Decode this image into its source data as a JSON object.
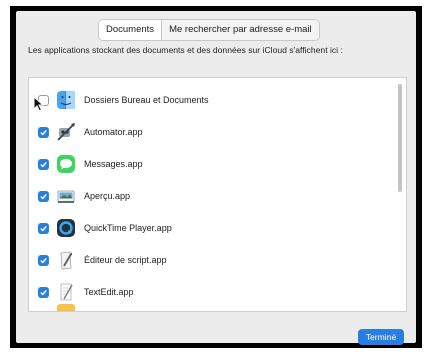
{
  "tabs": [
    {
      "label": "Documents",
      "selected": true
    },
    {
      "label": "Me rechercher par adresse e-mail",
      "selected": false
    }
  ],
  "description": "Les applications stockant des documents et des données sur iCloud s'affichent ici :",
  "apps": [
    {
      "label": "Dossiers Bureau et Documents",
      "checked": false,
      "icon": "finder-icon"
    },
    {
      "label": "Automator.app",
      "checked": true,
      "icon": "automator-icon"
    },
    {
      "label": "Messages.app",
      "checked": true,
      "icon": "messages-icon"
    },
    {
      "label": "Aperçu.app",
      "checked": true,
      "icon": "preview-icon"
    },
    {
      "label": "QuickTime Player.app",
      "checked": true,
      "icon": "quicktime-icon"
    },
    {
      "label": "Éditeur de script.app",
      "checked": true,
      "icon": "script-editor-icon"
    },
    {
      "label": "TextEdit.app",
      "checked": true,
      "icon": "textedit-icon"
    }
  ],
  "done_label": "Terminé",
  "colors": {
    "accent": "#2a7de1",
    "panel": "#ececec",
    "frame": "#000000"
  }
}
